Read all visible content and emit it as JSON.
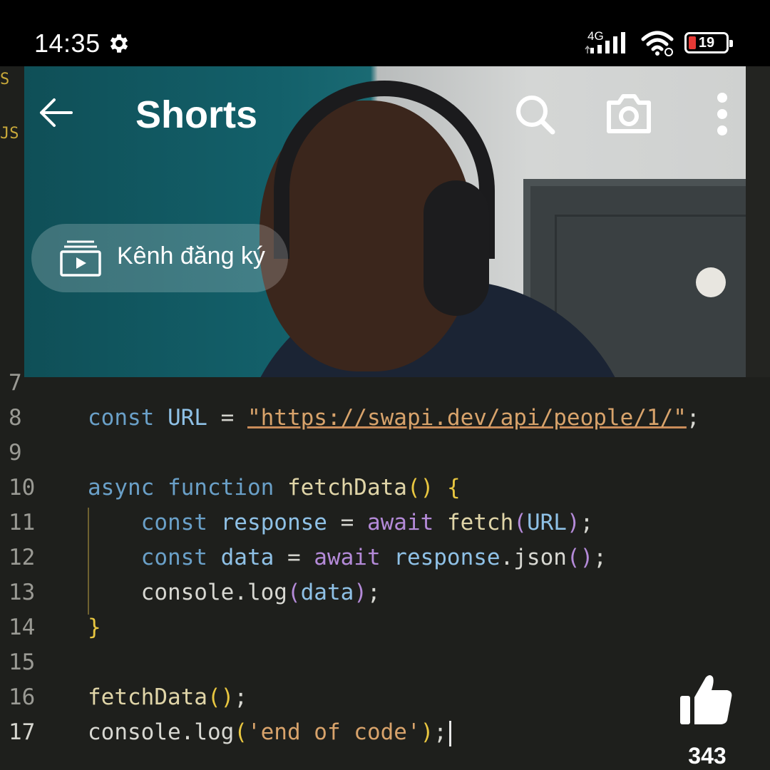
{
  "status_bar": {
    "time": "14:35",
    "network": "4G",
    "battery": "19",
    "battery_level_pct": 19,
    "icons": [
      "gear-icon",
      "signal-icon",
      "wifi-icon",
      "battery-icon"
    ]
  },
  "header": {
    "title": "Shorts",
    "icons": [
      "back-arrow-icon",
      "search-icon",
      "camera-icon",
      "more-vert-icon"
    ]
  },
  "subscriptions": {
    "label": "Kênh đăng ký",
    "icon": "subscriptions-icon"
  },
  "editor": {
    "gutter_marks": [
      "S",
      "JS"
    ],
    "lines": [
      {
        "num": "7"
      },
      {
        "num": "8",
        "tokens": [
          [
            "const ",
            "k-const"
          ],
          [
            "URL",
            "k-var"
          ],
          [
            " = ",
            "k-op"
          ],
          [
            "\"https://swapi.dev/api/people/1/\"",
            "k-str"
          ],
          [
            ";",
            "k-plain"
          ]
        ]
      },
      {
        "num": "9"
      },
      {
        "num": "10",
        "tokens": [
          [
            "async ",
            "k-const"
          ],
          [
            "function ",
            "k-const"
          ],
          [
            "fetchData",
            "k-fn"
          ],
          [
            "() ",
            "k-paren"
          ],
          [
            "{",
            "k-paren"
          ]
        ]
      },
      {
        "num": "11",
        "tokens": [
          [
            "    const ",
            "k-const"
          ],
          [
            "response",
            "k-var"
          ],
          [
            " = ",
            "k-op"
          ],
          [
            "await ",
            "k-await"
          ],
          [
            "fetch",
            "k-fn"
          ],
          [
            "(",
            "k-await"
          ],
          [
            "URL",
            "k-var"
          ],
          [
            ")",
            "k-await"
          ],
          [
            ";",
            "k-plain"
          ]
        ]
      },
      {
        "num": "12",
        "tokens": [
          [
            "    const ",
            "k-const"
          ],
          [
            "data",
            "k-var"
          ],
          [
            " = ",
            "k-op"
          ],
          [
            "await ",
            "k-await"
          ],
          [
            "response",
            "k-var"
          ],
          [
            ".json",
            "k-plain"
          ],
          [
            "()",
            "k-await"
          ],
          [
            ";",
            "k-plain"
          ]
        ]
      },
      {
        "num": "13",
        "tokens": [
          [
            "    console",
            "k-plain"
          ],
          [
            ".log",
            "k-plain"
          ],
          [
            "(",
            "k-await"
          ],
          [
            "data",
            "k-var"
          ],
          [
            ")",
            "k-await"
          ],
          [
            ";",
            "k-plain"
          ]
        ]
      },
      {
        "num": "14",
        "tokens": [
          [
            "}",
            "k-paren"
          ]
        ]
      },
      {
        "num": "15"
      },
      {
        "num": "16",
        "tokens": [
          [
            "fetchData",
            "k-fn"
          ],
          [
            "()",
            "k-paren"
          ],
          [
            ";",
            "k-plain"
          ]
        ]
      },
      {
        "num": "17",
        "tokens": [
          [
            "console",
            "k-plain"
          ],
          [
            ".log",
            "k-plain"
          ],
          [
            "(",
            "k-paren"
          ],
          [
            "'end of code'",
            "k-str2"
          ],
          [
            ")",
            "k-paren"
          ],
          [
            ";",
            "k-plain"
          ]
        ],
        "active": true
      }
    ]
  },
  "actions": {
    "like_count": "343",
    "like_icon": "thumbs-up-icon"
  }
}
